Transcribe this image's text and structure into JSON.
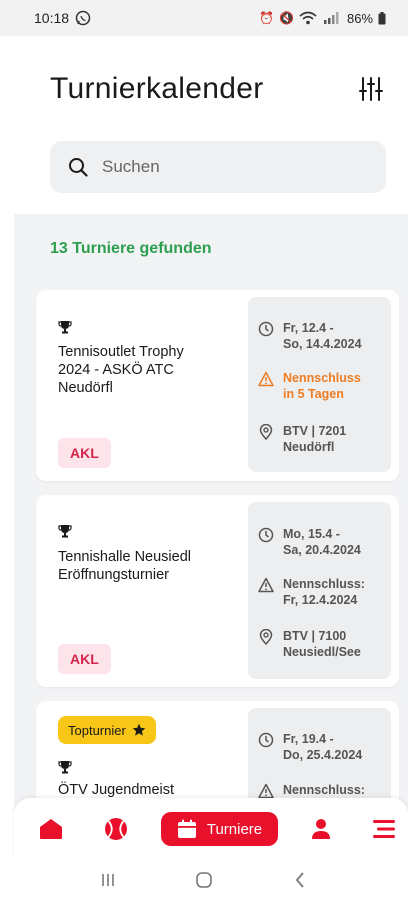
{
  "status_bar": {
    "time": "10:18",
    "battery": "86%"
  },
  "header": {
    "title": "Turnierkalender"
  },
  "search": {
    "placeholder": "Suchen"
  },
  "results": {
    "count_text": "13 Turniere gefunden"
  },
  "tournaments": [
    {
      "name_lines": [
        "Tennisoutlet Trophy",
        "2024 - ASKÖ ATC",
        "Neudörfl"
      ],
      "category": "AKL",
      "date_lines": [
        "Fr, 12.4 -",
        "So, 14.4.2024"
      ],
      "deadline_lines": [
        "Nennschluss",
        "in 5 Tagen"
      ],
      "deadline_warning": true,
      "location_lines": [
        "BTV | 7201",
        "Neudörfl"
      ]
    },
    {
      "name_lines": [
        "Tennishalle Neusiedl",
        "Eröffnungsturnier"
      ],
      "category": "AKL",
      "date_lines": [
        "Mo, 15.4 -",
        "Sa, 20.4.2024"
      ],
      "deadline_lines": [
        "Nennschluss:",
        "Fr, 12.4.2024"
      ],
      "deadline_warning": false,
      "location_lines": [
        "BTV | 7100",
        "Neusiedl/See"
      ]
    },
    {
      "top_badge": "Topturnier",
      "name_lines": [
        "ÖTV Jugendmeist"
      ],
      "date_lines": [
        "Fr, 19.4 -",
        "Do, 25.4.2024"
      ],
      "deadline_lines": [
        "Nennschluss:"
      ],
      "deadline_warning": false
    }
  ],
  "bottom_nav": {
    "active_label": "Turniere"
  },
  "colors": {
    "brand_red": "#e8102a",
    "success_green": "#2e9e4f",
    "warning_orange": "#ee7d24",
    "top_yellow": "#f7c616"
  }
}
